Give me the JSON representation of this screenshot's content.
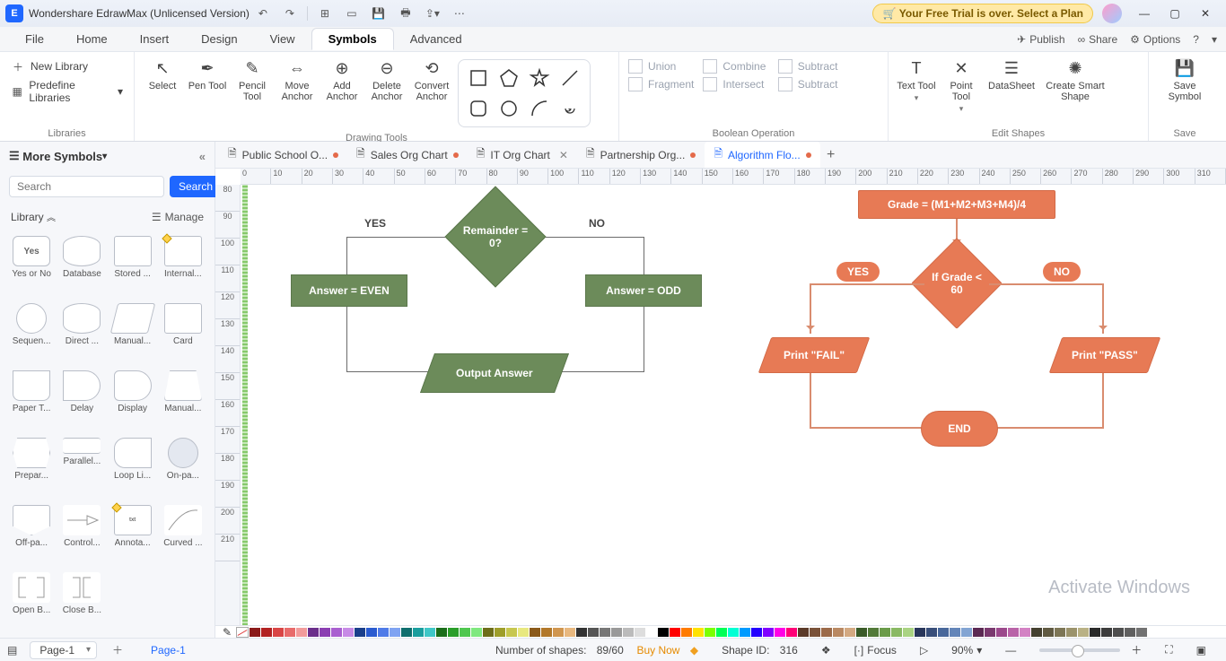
{
  "titlebar": {
    "app_title": "Wondershare EdrawMax (Unlicensed Version)",
    "trial_text": "Your Free Trial is over. Select a Plan"
  },
  "menu": {
    "items": [
      "File",
      "Home",
      "Insert",
      "Design",
      "View",
      "Symbols",
      "Advanced"
    ],
    "active": "Symbols",
    "right": {
      "publish": "Publish",
      "share": "Share",
      "options": "Options"
    }
  },
  "ribbon": {
    "libraries": {
      "new": "New Library",
      "predef": "Predefine Libraries",
      "label": "Libraries"
    },
    "drawing": {
      "select": "Select",
      "pen": "Pen Tool",
      "pencil": "Pencil Tool",
      "move": "Move Anchor",
      "add": "Add Anchor",
      "delete": "Delete Anchor",
      "convert": "Convert Anchor",
      "label": "Drawing Tools"
    },
    "boolean": {
      "union": "Union",
      "combine": "Combine",
      "subtract": "Subtract",
      "fragment": "Fragment",
      "intersect": "Intersect",
      "subtract2": "Subtract",
      "label": "Boolean Operation"
    },
    "edit": {
      "text": "Text Tool",
      "point": "Point Tool",
      "datasheet": "DataSheet",
      "smart": "Create Smart Shape",
      "label": "Edit Shapes"
    },
    "save": {
      "save": "Save Symbol",
      "label": "Save"
    }
  },
  "left": {
    "more": "More Symbols",
    "search_placeholder": "Search",
    "search_btn": "Search",
    "library": "Library",
    "manage": "Manage",
    "items": [
      "Yes or No",
      "Database",
      "Stored ...",
      "Internal...",
      "Sequen...",
      "Direct ...",
      "Manual...",
      "Card",
      "Paper T...",
      "Delay",
      "Display",
      "Manual...",
      "Prepar...",
      "Parallel...",
      "Loop Li...",
      "On-pa...",
      "Off-pa...",
      "Control...",
      "Annota...",
      "Curved ...",
      "Open B...",
      "Close B..."
    ],
    "yes_shape_text": "Yes"
  },
  "tabs": [
    {
      "label": "Public School O...",
      "dirty": true
    },
    {
      "label": "Sales Org Chart",
      "dirty": true
    },
    {
      "label": "IT Org Chart",
      "dirty": false,
      "closable": true
    },
    {
      "label": "Partnership Org...",
      "dirty": true
    },
    {
      "label": "Algorithm Flo...",
      "dirty": true,
      "active": true
    }
  ],
  "flow": {
    "yes": "YES",
    "no": "NO",
    "remainder": "Remainder = 0?",
    "even": "Answer = EVEN",
    "odd": "Answer = ODD",
    "output": "Output Answer",
    "grade_formula": "Grade = (M1+M2+M3+M4)/4",
    "if_grade": "If Grade < 60",
    "fail": "Print \"FAIL\"",
    "pass": "Print \"PASS\"",
    "end": "END"
  },
  "watermark": "Activate Windows",
  "status": {
    "page": "Page-1",
    "page_tab": "Page-1",
    "shapes_label": "Number of shapes:",
    "shapes": "89/60",
    "buy": "Buy Now",
    "shape_id_label": "Shape ID:",
    "shape_id": "316",
    "focus": "Focus",
    "zoom": "90%"
  },
  "ruler_h": [
    "0",
    "10",
    "20",
    "30",
    "40",
    "50",
    "60",
    "70",
    "80",
    "90",
    "100",
    "110",
    "120",
    "130",
    "140",
    "150",
    "160",
    "170",
    "180",
    "190",
    "200",
    "210",
    "220",
    "230",
    "240",
    "250",
    "260",
    "270",
    "280",
    "290",
    "300",
    "310"
  ],
  "ruler_v": [
    "80",
    "90",
    "100",
    "110",
    "120",
    "130",
    "140",
    "150",
    "160",
    "170",
    "180",
    "190",
    "200",
    "210"
  ]
}
